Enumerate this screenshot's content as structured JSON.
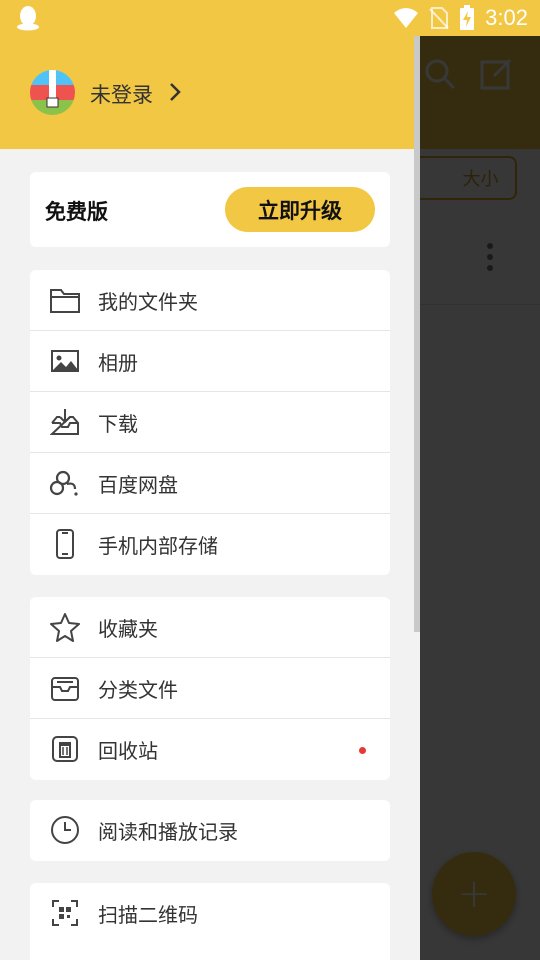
{
  "status_bar": {
    "time": "3:02"
  },
  "background_app": {
    "sort_button_label": "大小",
    "fab_label": "+"
  },
  "drawer": {
    "login_text": "未登录",
    "plan_label": "免费版",
    "upgrade_label": "立即升级",
    "sections": [
      {
        "items": [
          {
            "label": "我的文件夹",
            "icon": "folder-icon"
          },
          {
            "label": "相册",
            "icon": "image-icon"
          },
          {
            "label": "下载",
            "icon": "download-icon"
          },
          {
            "label": "百度网盘",
            "icon": "cloud-drive-icon"
          },
          {
            "label": "手机内部存储",
            "icon": "phone-icon"
          }
        ]
      },
      {
        "items": [
          {
            "label": "收藏夹",
            "icon": "star-icon"
          },
          {
            "label": "分类文件",
            "icon": "inbox-icon"
          },
          {
            "label": "回收站",
            "icon": "trash-icon",
            "badge_dot": true
          }
        ]
      },
      {
        "items": [
          {
            "label": "阅读和播放记录",
            "icon": "clock-icon"
          }
        ]
      },
      {
        "items": [
          {
            "label": "扫描二维码",
            "icon": "qr-scan-icon"
          }
        ]
      }
    ]
  },
  "colors": {
    "accent": "#f2c744",
    "badge": "#e53935"
  }
}
